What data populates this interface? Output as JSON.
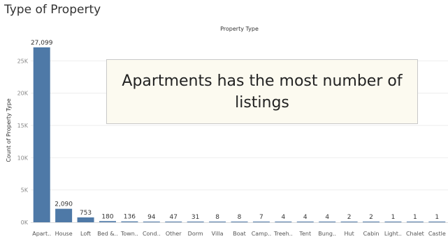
{
  "page": {
    "title": "Type of Property"
  },
  "annotation": {
    "text": "Apartments has the most number of listings"
  },
  "colors": {
    "bar": "#4e79a7",
    "grid": "#eeeeee",
    "axis": "#dddddd",
    "underline": "#333333"
  },
  "chart_data": {
    "type": "bar",
    "title": "Property Type",
    "ylabel": "Count of Property Type",
    "xlabel": "",
    "ylim": [
      0,
      28500
    ],
    "yticks": [
      0,
      5000,
      10000,
      15000,
      20000,
      25000
    ],
    "ytick_labels": [
      "0K",
      "5K",
      "10K",
      "15K",
      "20K",
      "25K"
    ],
    "grid": true,
    "categories": [
      "Apart..",
      "House",
      "Loft",
      "Bed &..",
      "Town..",
      "Cond..",
      "Other",
      "Dorm",
      "Villa",
      "Boat",
      "Camp..",
      "Treeh..",
      "Tent",
      "Bung..",
      "Hut",
      "Cabin",
      "Light..",
      "Chalet",
      "Castle"
    ],
    "values": [
      27099,
      2090,
      753,
      180,
      136,
      94,
      47,
      31,
      8,
      8,
      7,
      4,
      4,
      4,
      2,
      2,
      1,
      1,
      1
    ],
    "value_labels": [
      "27,099",
      "2,090",
      "753",
      "180",
      "136",
      "94",
      "47",
      "31",
      "8",
      "8",
      "7",
      "4",
      "4",
      "4",
      "2",
      "2",
      "1",
      "1",
      "1"
    ]
  }
}
